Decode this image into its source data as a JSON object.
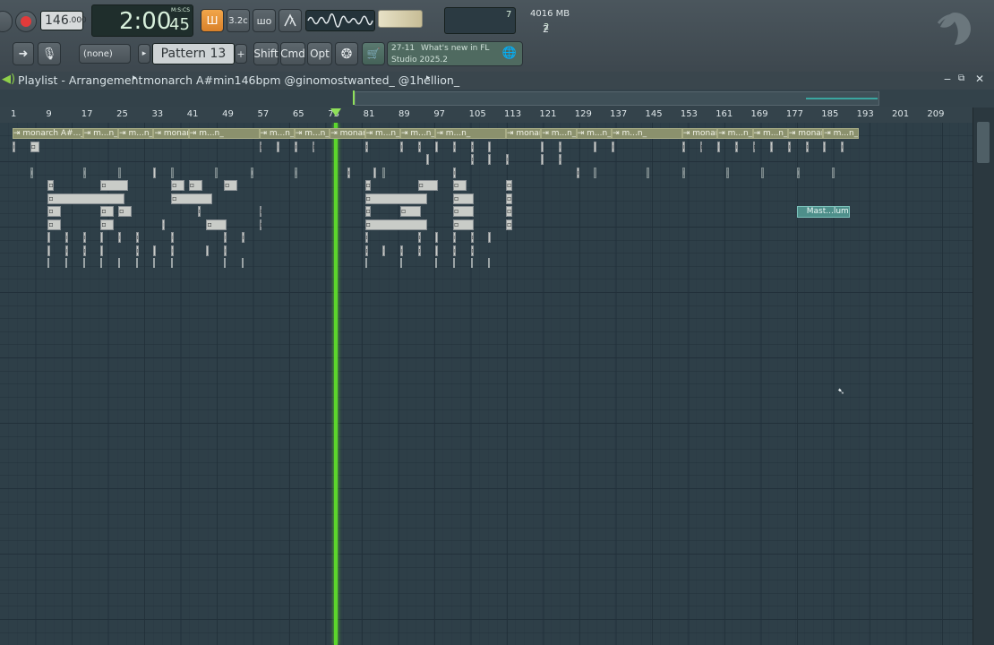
{
  "toolbar": {
    "tempo": "146",
    "tempo_decimals": ".000",
    "time_main": "2:00",
    "time_sub": "45",
    "time_format": "M:S:CS",
    "cpu_value": "7",
    "memory": "4016 MB",
    "polyphony": "2",
    "pattern_selector": "(none)",
    "pattern_name": "Pattern 13",
    "shift_label": "Shift",
    "cmd_label": "Cmd",
    "opt_label": "Opt",
    "news_date": "27-11",
    "news_text_line1": "What's new in FL",
    "news_text_line2": "Studio 2025.2",
    "plus_label": "+",
    "snap_icon": "3.2c",
    "stretch_icon": "шо"
  },
  "playlist": {
    "title": "Playlist - Arrangement",
    "project": "monarch A#min146bpm @ginomostwanted_ @1hellion_",
    "ruler_ticks": [
      "1",
      "9",
      "17",
      "25",
      "33",
      "41",
      "49",
      "57",
      "65",
      "73",
      "81",
      "89",
      "97",
      "105",
      "113",
      "121",
      "129",
      "137",
      "145",
      "153",
      "161",
      "169",
      "177",
      "185",
      "193",
      "201",
      "209"
    ],
    "audio_track": [
      "monarch A#..._@1hellion_",
      "m...n_",
      "m...n_",
      "monarch A#..._@1hellion_",
      "m...n_",
      "m...n_",
      "m...n_",
      "monarch A#..._@1hellion_",
      "m...n_",
      "m...n_",
      "m...n_",
      "monarch A#..._@1hellion_",
      "m...n_",
      "m...n_",
      "m...n_"
    ],
    "pattern_labels": [
      "Pat...1",
      "Pat...1",
      "Pat...2",
      "Pat...1",
      "Pat...1",
      "Pat...1",
      "Pat...1",
      "Pat...1",
      "Pat...1",
      "Pat...1",
      "Pat...1",
      "Pat...1",
      "Pat...1",
      "Pat...3",
      "Pat...1"
    ],
    "automation_label": "Mast...lume"
  },
  "colors": {
    "playhead": "#5cd62c",
    "background": "#2e3f48",
    "audio_clip": "#8b916d",
    "pattern_clip": "#c9ccc8",
    "automation_clip": "#4e8f8a"
  }
}
